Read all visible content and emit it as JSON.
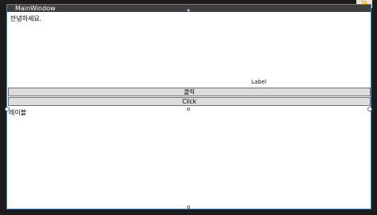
{
  "window": {
    "title": "MainWindow"
  },
  "content": {
    "greeting_text": "안녕하세요.",
    "right_label": "Label",
    "button_primary_label": "클릭",
    "button_secondary_label": "Click",
    "bottom_label": "레이블"
  },
  "icons": {
    "corner": "lightbulb-icon",
    "handles": "resize-handle-icon"
  },
  "colors": {
    "titlebar": "#3f3f3f",
    "button_bg": "#dddddd",
    "selection_border": "#5a7fa6"
  }
}
